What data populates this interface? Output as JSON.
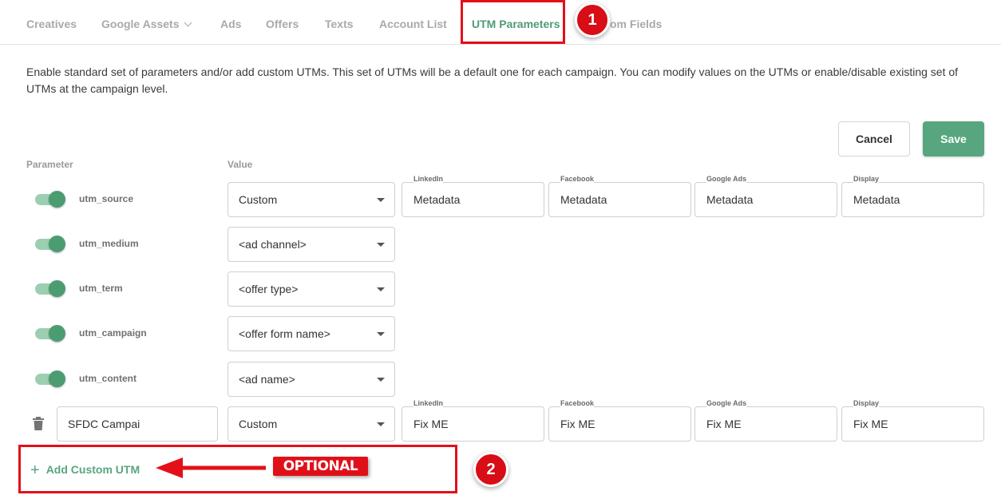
{
  "tabs": [
    {
      "label": "Creatives"
    },
    {
      "label": "Google Assets"
    },
    {
      "label": "Ads"
    },
    {
      "label": "Offers"
    },
    {
      "label": "Texts"
    },
    {
      "label": "Account List"
    },
    {
      "label": "UTM Parameters",
      "active": true
    },
    {
      "label": "om Fields"
    }
  ],
  "annotations": {
    "marker1": "1",
    "marker2": "2",
    "optional": "OPTIONAL"
  },
  "description": "Enable standard set of parameters and/or add custom UTMs. This set of UTMs will be a default one for each campaign. You can modify values on the UTMs or enable/disable existing set of UTMs at the campaign level.",
  "actions": {
    "cancel": "Cancel",
    "save": "Save"
  },
  "columns": {
    "parameter": "Parameter",
    "value": "Value"
  },
  "platforms": [
    "LinkedIn",
    "Facebook",
    "Google Ads",
    "Display"
  ],
  "parameters": [
    {
      "name": "utm_source",
      "enabled": true,
      "value": "Custom",
      "platform_values": [
        "Metadata",
        "Metadata",
        "Metadata",
        "Metadata"
      ]
    },
    {
      "name": "utm_medium",
      "enabled": true,
      "value": "<ad channel>"
    },
    {
      "name": "utm_term",
      "enabled": true,
      "value": "<offer type>"
    },
    {
      "name": "utm_campaign",
      "enabled": true,
      "value": "<offer form name>"
    },
    {
      "name": "utm_content",
      "enabled": true,
      "value": "<ad name>"
    }
  ],
  "custom_utm": {
    "name": "SFDC Campai",
    "value": "Custom",
    "platform_values": [
      "Fix ME",
      "Fix ME",
      "Fix ME",
      "Fix ME"
    ]
  },
  "add_custom_utm": {
    "icon": "plus-icon",
    "label": "Add Custom UTM"
  },
  "colors": {
    "accent": "#58a67f",
    "annotation_red": "#e3101a",
    "toggle_on": "#4c9c72"
  }
}
